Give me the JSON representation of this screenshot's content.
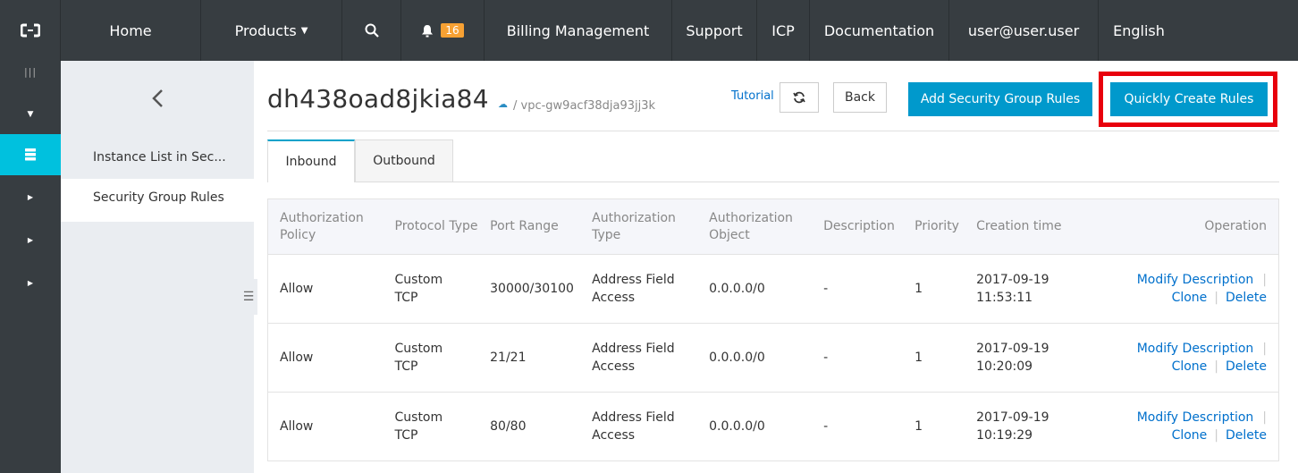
{
  "nav": {
    "home": "Home",
    "products": "Products",
    "notification_count": "16",
    "billing": "Billing Management",
    "support": "Support",
    "icp": "ICP",
    "documentation": "Documentation",
    "user": "user@user.user",
    "language": "English"
  },
  "sidebar": {
    "items": [
      {
        "label": "Instance List in Sec..."
      },
      {
        "label": "Security Group Rules"
      }
    ]
  },
  "header": {
    "title": "dh438oad8jkia84",
    "vpc": "/ vpc-gw9acf38dja93jj3k",
    "tutorial": "Tutorial",
    "back": "Back",
    "add_rules": "Add Security Group Rules",
    "quick_create": "Quickly Create Rules"
  },
  "tabs": [
    {
      "label": "Inbound"
    },
    {
      "label": "Outbound"
    }
  ],
  "table": {
    "columns": [
      "Authorization Policy",
      "Protocol Type",
      "Port Range",
      "Authorization Type",
      "Authorization Object",
      "Description",
      "Priority",
      "Creation time",
      "Operation"
    ],
    "rows": [
      {
        "policy": "Allow",
        "protocol": "Custom TCP",
        "port": "30000/30100",
        "auth_type": "Address Field Access",
        "object": "0.0.0.0/0",
        "description": "-",
        "priority": "1",
        "time": "2017-09-19 11:53:11"
      },
      {
        "policy": "Allow",
        "protocol": "Custom TCP",
        "port": "21/21",
        "auth_type": "Address Field Access",
        "object": "0.0.0.0/0",
        "description": "-",
        "priority": "1",
        "time": "2017-09-19 10:20:09"
      },
      {
        "policy": "Allow",
        "protocol": "Custom TCP",
        "port": "80/80",
        "auth_type": "Address Field Access",
        "object": "0.0.0.0/0",
        "description": "-",
        "priority": "1",
        "time": "2017-09-19 10:19:29"
      }
    ],
    "actions": {
      "modify": "Modify Description",
      "clone": "Clone",
      "delete": "Delete"
    }
  },
  "colors": {
    "nav_bg": "#373d41",
    "accent": "#00c1de",
    "primary_button": "#0099cc",
    "link": "#0070cc",
    "highlight": "#e8000c"
  }
}
